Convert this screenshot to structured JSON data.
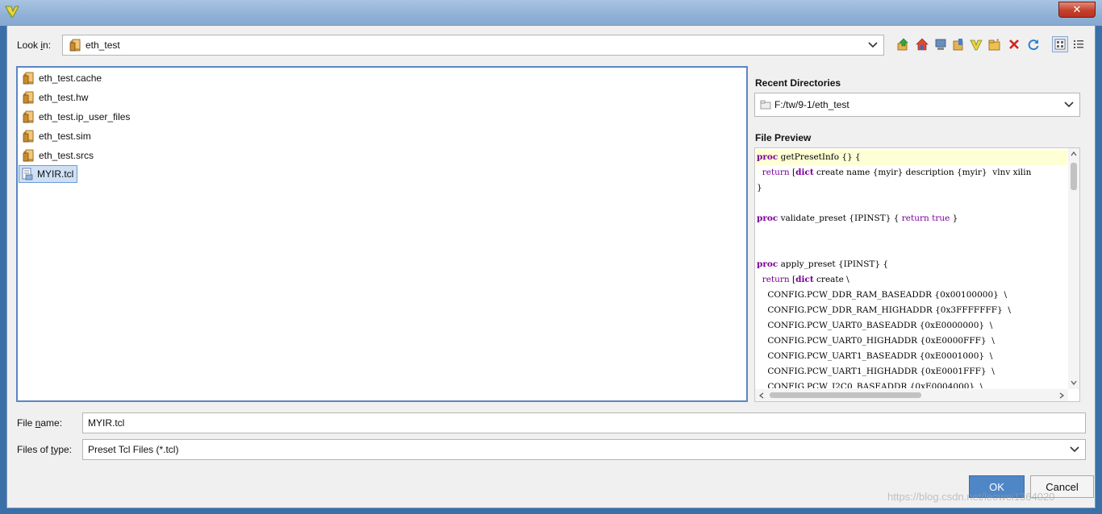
{
  "dialog": {
    "close_label": "✕",
    "look_in_label_pre": "Look ",
    "look_in_label_u": "i",
    "look_in_label_post": "n:",
    "look_in_value": "eth_test",
    "recent_directories_label": "Recent Directories",
    "recent_directory_value": "F:/tw/9-1/eth_test",
    "file_preview_label": "File Preview",
    "file_name_label_pre": "File ",
    "file_name_label_u": "n",
    "file_name_label_post": "ame:",
    "file_name_value": "MYIR.tcl",
    "files_of_type_label_pre": "Files of ",
    "files_of_type_label_u": "t",
    "files_of_type_label_post": "ype:",
    "files_of_type_value": "Preset Tcl Files (*.tcl)",
    "ok_label": "OK",
    "cancel_label": "Cancel"
  },
  "toolbar": [
    "up-folder-icon",
    "home-icon",
    "computer-icon",
    "bookmarks-icon",
    "project-icon",
    "new-folder-icon",
    "delete-icon",
    "refresh-icon",
    "grid-view-icon",
    "list-view-icon"
  ],
  "files": [
    {
      "name": "eth_test.cache",
      "kind": "folder"
    },
    {
      "name": "eth_test.hw",
      "kind": "folder"
    },
    {
      "name": "eth_test.ip_user_files",
      "kind": "folder"
    },
    {
      "name": "eth_test.sim",
      "kind": "folder"
    },
    {
      "name": "eth_test.srcs",
      "kind": "folder"
    },
    {
      "name": "MYIR.tcl",
      "kind": "tcl",
      "selected": true
    }
  ],
  "preview_lines": [
    {
      "kw": "proc",
      "rest": " getPresetInfo {} {"
    },
    {
      "indent": "  ",
      "kw2": "return",
      "mid": " [",
      "kw": "dict",
      "rest": " create name {myir} description {myir}  vlnv xilin"
    },
    {
      "rest": "}"
    },
    {
      "rest": ""
    },
    {
      "kw": "proc",
      "rest": " validate_preset {IPINST} { ",
      "kw2b": "return",
      "mid2": " ",
      "kw3": "true",
      "tail": " }"
    },
    {
      "rest": ""
    },
    {
      "rest": ""
    },
    {
      "kw": "proc",
      "rest": " apply_preset {IPINST} {"
    },
    {
      "indent": "  ",
      "kw2": "return",
      "mid": " [",
      "kw": "dict",
      "rest": " create \\"
    },
    {
      "rest": "    CONFIG.PCW_DDR_RAM_BASEADDR {0x00100000}  \\"
    },
    {
      "rest": "    CONFIG.PCW_DDR_RAM_HIGHADDR {0x3FFFFFFF}  \\"
    },
    {
      "rest": "    CONFIG.PCW_UART0_BASEADDR {0xE0000000}  \\"
    },
    {
      "rest": "    CONFIG.PCW_UART0_HIGHADDR {0xE0000FFF}  \\"
    },
    {
      "rest": "    CONFIG.PCW_UART1_BASEADDR {0xE0001000}  \\"
    },
    {
      "rest": "    CONFIG.PCW_UART1_HIGHADDR {0xE0001FFF}  \\"
    },
    {
      "rest": "    CONFIG.PCW_I2C0_BASEADDR {0xE0004000}  \\"
    }
  ],
  "watermark": "https://blog.csdn.net/leowei1364020",
  "colors": {
    "accent": "#4f86c6",
    "folder": "#d9a441",
    "keyword": "#7a0099",
    "highlight_line": "#ffffd6"
  }
}
